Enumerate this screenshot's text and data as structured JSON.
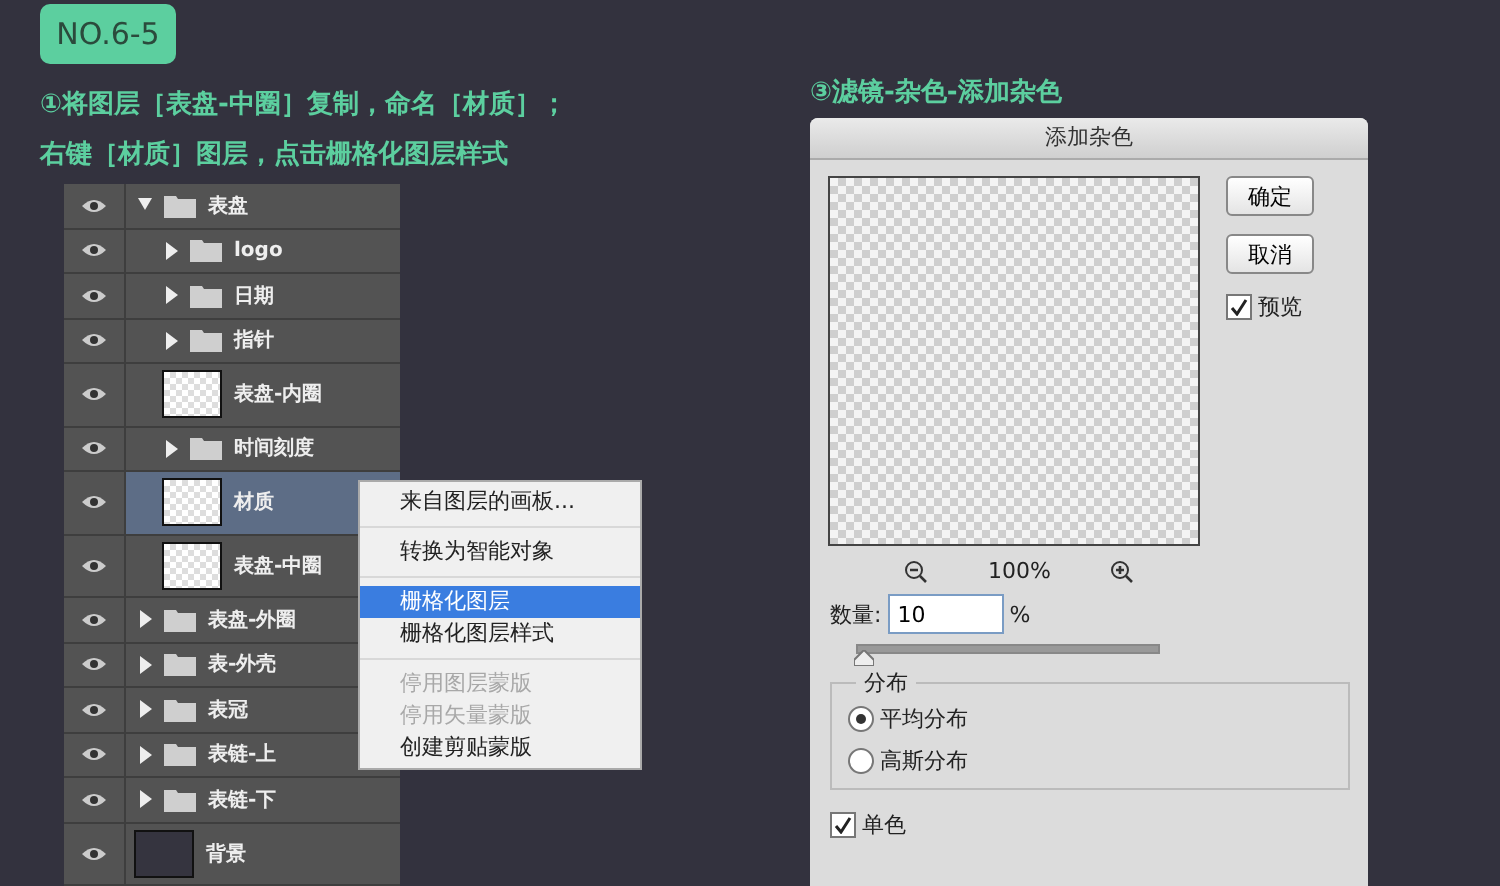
{
  "badge": "NO.6-5",
  "steps": [
    "①将图层［表盘-中圈］复制，命名［材质］；",
    "右键［材质］图层，点击栅格化图层样式"
  ],
  "layers": [
    {
      "name": "表盘",
      "kind": "group",
      "expanded": true,
      "selected": false,
      "children": [
        {
          "name": "logo",
          "kind": "group",
          "expanded": false,
          "selected": false
        },
        {
          "name": "日期",
          "kind": "group",
          "expanded": false,
          "selected": false
        },
        {
          "name": "指针",
          "kind": "group",
          "expanded": false,
          "selected": false
        },
        {
          "name": "表盘-内圈",
          "kind": "layer",
          "selected": false
        },
        {
          "name": "时间刻度",
          "kind": "group",
          "expanded": false,
          "selected": false
        },
        {
          "name": "材质",
          "kind": "layer",
          "selected": true
        },
        {
          "name": "表盘-中圈",
          "kind": "layer",
          "selected": false
        }
      ]
    },
    {
      "name": "表盘-外圈",
      "kind": "group",
      "expanded": false,
      "selected": false
    },
    {
      "name": "表-外壳",
      "kind": "group",
      "expanded": false,
      "selected": false
    },
    {
      "name": "表冠",
      "kind": "group",
      "expanded": false,
      "selected": false
    },
    {
      "name": "表链-上",
      "kind": "group",
      "expanded": false,
      "selected": false
    },
    {
      "name": "表链-下",
      "kind": "group",
      "expanded": false,
      "selected": false
    },
    {
      "name": "背景",
      "kind": "background",
      "selected": false
    }
  ],
  "context_menu": [
    {
      "label": "来自图层的画板...",
      "selected": false,
      "disabled": false,
      "separator_before": false
    },
    {
      "label": "转换为智能对象",
      "selected": false,
      "disabled": false,
      "separator_before": true
    },
    {
      "label": "栅格化图层",
      "selected": true,
      "disabled": false,
      "separator_before": true
    },
    {
      "label": "栅格化图层样式",
      "selected": false,
      "disabled": false,
      "separator_before": false
    },
    {
      "label": "停用图层蒙版",
      "selected": false,
      "disabled": true,
      "separator_before": true
    },
    {
      "label": "停用矢量蒙版",
      "selected": false,
      "disabled": true,
      "separator_before": false
    },
    {
      "label": "创建剪贴蒙版",
      "selected": false,
      "disabled": false,
      "separator_before": false
    }
  ],
  "step_3": "③滤镜-杂色-添加杂色",
  "dialog": {
    "title": "添加杂色",
    "buttons": [
      "确定",
      "取消"
    ],
    "preview": {
      "label": "预览",
      "checked": true
    },
    "zoom": "100%",
    "amount": {
      "label": "数量:",
      "value": "10",
      "unit": "%",
      "level": 0.02
    },
    "distribution": {
      "title": "分布",
      "options": [
        {
          "label": "平均分布",
          "selected": true
        },
        {
          "label": "高斯分布",
          "selected": false
        }
      ]
    },
    "monochrome": {
      "label": "单色",
      "checked": true
    }
  }
}
